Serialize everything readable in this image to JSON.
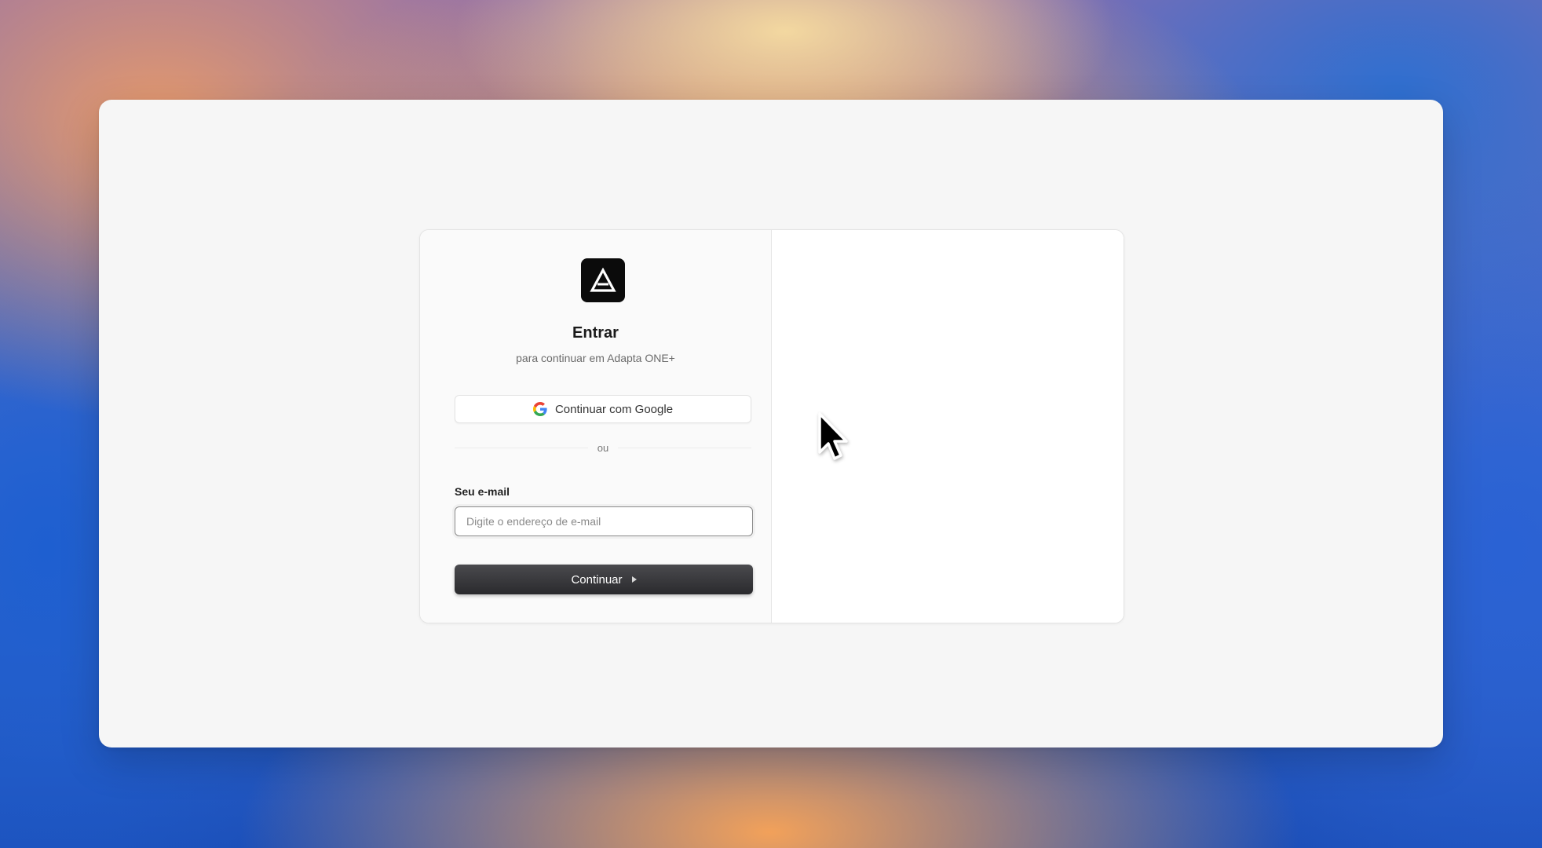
{
  "auth": {
    "title": "Entrar",
    "subtitle": "para continuar em Adapta ONE+",
    "google_button_label": "Continuar com Google",
    "divider_text": "ou",
    "email_label": "Seu e-mail",
    "email_placeholder": "Digite o endereço de e-mail",
    "email_value": "",
    "continue_label": "Continuar"
  },
  "icons": {
    "logo": "adapta-triangle-logo-icon",
    "google": "google-g-icon",
    "continue_caret": "caret-right-icon",
    "cursor": "mouse-pointer-icon"
  },
  "colors": {
    "logo_background": "#0b0b0b",
    "primary_button": "#2a2a2d",
    "window_background": "#f6f6f6",
    "card_background": "#ffffff"
  }
}
